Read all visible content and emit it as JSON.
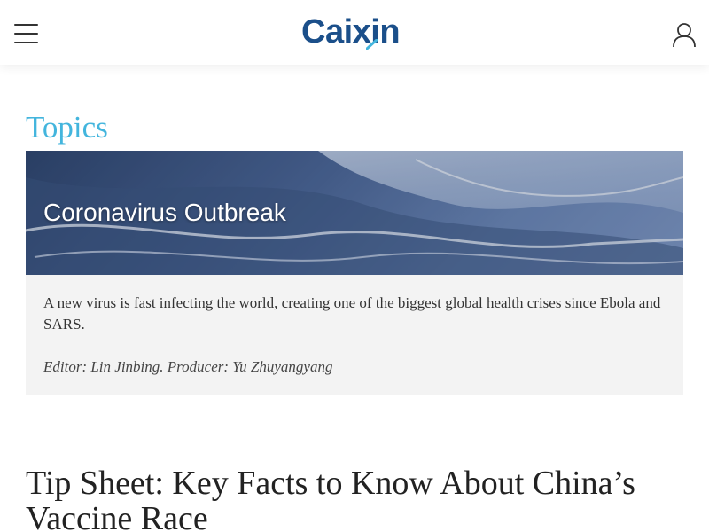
{
  "header": {
    "logo_text": "Caixin",
    "menu_icon": "hamburger-menu-icon",
    "user_icon": "user-icon",
    "logo_color": "#1b4f8a",
    "accent_color": "#43b5dd"
  },
  "topics": {
    "section_title": "Topics",
    "card": {
      "title": "Coronavirus Outbreak",
      "description": "A new virus is fast infecting the world, creating one of the biggest global health crises since Ebola and SARS.",
      "credit": "Editor: Lin Jinbing. Producer: Yu Zhuyangyang"
    }
  },
  "article": {
    "headline": "Tip Sheet: Key Facts to Know About China’s Vaccine Race"
  }
}
